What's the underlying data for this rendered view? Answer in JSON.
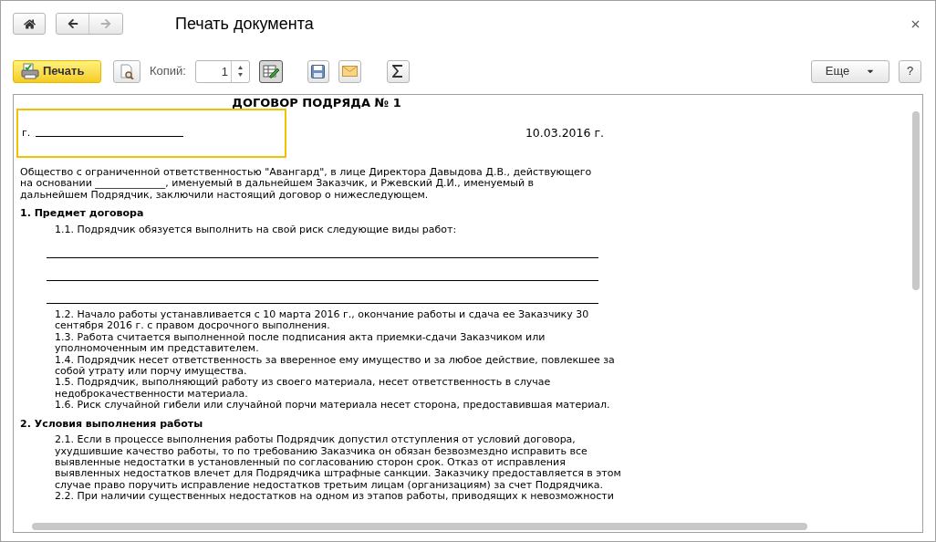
{
  "window": {
    "title": "Печать документа",
    "forward_disabled": true
  },
  "toolbar": {
    "print": "Печать",
    "copies_label": "Копий:",
    "copies": "1",
    "edit_selected": true,
    "more": "Еще",
    "help": "?"
  },
  "document": {
    "title": "ДОГОВОР ПОДРЯДА № 1",
    "city_label": "г.",
    "city_cell_selected": true,
    "date": "10.03.2016 г.",
    "preamble": "Общество с ограниченной ответственностью \"Авангард\", в лице Директора Давыдова Д.В., действующего на основании ______________, именуемый в дальнейшем Заказчик, и Ржевский Д.И., именуемый в дальнейшем Подрядчик, заключили настоящий договор о нижеследующем.",
    "sections": [
      {
        "heading": "1. Предмет договора",
        "items": [
          {
            "kind": "paragraph",
            "text": "1.1. Подрядчик обязуется выполнить на свой риск следующие виды работ:"
          },
          {
            "kind": "fill-line"
          },
          {
            "kind": "fill-line"
          },
          {
            "kind": "fill-line"
          },
          {
            "kind": "paragraph",
            "text": "1.2. Начало работы устанавливается с 10 марта 2016 г., окончание работы и сдача ее Заказчику 30 сентября 2016 г. с правом досрочного выполнения."
          },
          {
            "kind": "paragraph",
            "text": "1.3. Работа считается выполненной после подписания акта приемки-сдачи Заказчиком или уполномоченным им представителем."
          },
          {
            "kind": "paragraph",
            "text": "1.4. Подрядчик несет ответственность за вверенное ему имущество и за любое действие, повлекшее за собой утрату или порчу имущества."
          },
          {
            "kind": "paragraph",
            "text": "1.5. Подрядчик, выполняющий работу из своего материала, несет ответственность в случае недоброкачественности материала."
          },
          {
            "kind": "paragraph",
            "text": "1.6. Риск случайной гибели или случайной порчи материала несет сторона, предоставившая материал."
          }
        ]
      },
      {
        "heading": "2. Условия выполнения работы",
        "items": [
          {
            "kind": "paragraph",
            "text": "2.1. Если в процессе выполнения работы Подрядчик допустил отступления от условий договора, ухудшившие качество работы, то по требованию Заказчика он обязан безвозмездно исправить все выявленные недостатки в установленный по согласованию сторон срок. Отказ от исправления выявленных недостатков влечет для Подрядчика штрафные санкции. Заказчику предоставляется в этом случае право поручить исправление недостатков третьим лицам (организациям) за счет Подрядчика."
          },
          {
            "kind": "paragraph",
            "text": "2.2. При наличии существенных недостатков на одном из этапов работы, приводящих к невозможности"
          }
        ]
      }
    ]
  }
}
